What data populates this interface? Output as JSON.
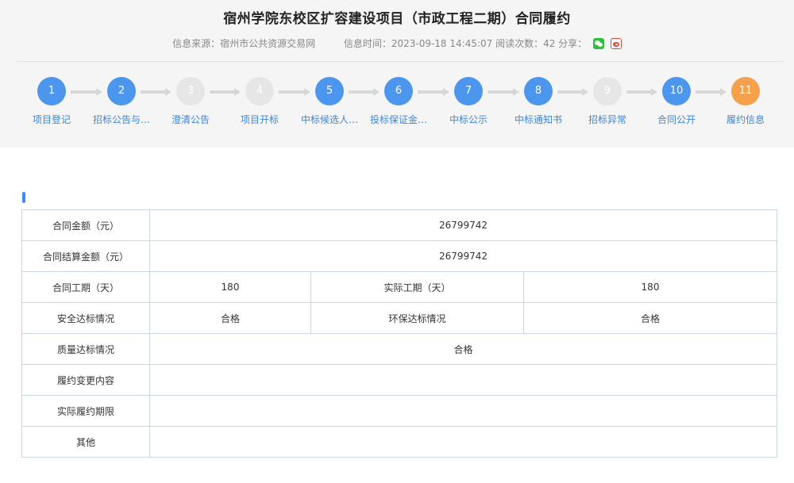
{
  "header": {
    "title": "宿州学院东校区扩容建设项目（市政工程二期）合同履约",
    "source_text": "信息来源：宿州市公共资源交易网",
    "time_text": "信息时间：2023-09-18 14:45:07 阅读次数：42 分享："
  },
  "colors": {
    "step_done": "#4d96ee",
    "step_pending": "#e6e6e6",
    "step_current": "#f5a04a",
    "link_blue": "#3c87d8"
  },
  "steps": [
    {
      "num": "1",
      "label": "项目登记",
      "state": "done"
    },
    {
      "num": "2",
      "label": "招标公告与…",
      "state": "done"
    },
    {
      "num": "3",
      "label": "澄清公告",
      "state": "pending"
    },
    {
      "num": "4",
      "label": "项目开标",
      "state": "pending"
    },
    {
      "num": "5",
      "label": "中标候选人…",
      "state": "done"
    },
    {
      "num": "6",
      "label": "投标保证金…",
      "state": "done"
    },
    {
      "num": "7",
      "label": "中标公示",
      "state": "done"
    },
    {
      "num": "8",
      "label": "中标通知书",
      "state": "done"
    },
    {
      "num": "9",
      "label": "招标异常",
      "state": "pending"
    },
    {
      "num": "10",
      "label": "合同公开",
      "state": "done"
    },
    {
      "num": "11",
      "label": "履约信息",
      "state": "current"
    }
  ],
  "table": {
    "contract_amount_label": "合同金额（元）",
    "contract_amount_value": "26799742",
    "settlement_amount_label": "合同结算金额（元）",
    "settlement_amount_value": "26799742",
    "contract_period_label": "合同工期（天）",
    "contract_period_value": "180",
    "actual_period_label": "实际工期（天）",
    "actual_period_value": "180",
    "safety_label": "安全达标情况",
    "safety_value": "合格",
    "env_label": "环保达标情况",
    "env_value": "合格",
    "quality_label": "质量达标情况",
    "quality_value": "合格",
    "change_label": "履约变更内容",
    "change_value": "",
    "actual_deadline_label": "实际履约期限",
    "actual_deadline_value": "",
    "other_label": "其他",
    "other_value": ""
  }
}
